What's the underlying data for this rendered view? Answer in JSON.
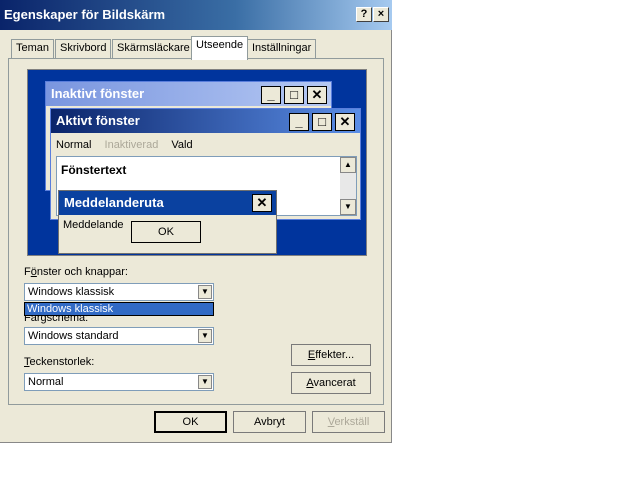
{
  "window": {
    "title": "Egenskaper för Bildskärm",
    "help_button": "?",
    "close_button": "×"
  },
  "tabs": [
    {
      "label": "Teman",
      "active": false
    },
    {
      "label": "Skrivbord",
      "active": false
    },
    {
      "label": "Skärmsläckare",
      "active": false
    },
    {
      "label": "Utseende",
      "active": true
    },
    {
      "label": "Inställningar",
      "active": false
    }
  ],
  "preview": {
    "inactive_title": "Inaktivt fönster",
    "active_title": "Aktivt fönster",
    "menu": {
      "normal": "Normal",
      "disabled": "Inaktiverad",
      "selected": "Vald"
    },
    "window_text": "Fönstertext",
    "messagebox_title": "Meddelanderuta",
    "message_text": "Meddelande",
    "ok_label": "OK"
  },
  "controls": {
    "windows_buttons_label_pre": "F",
    "windows_buttons_label_u": "ö",
    "windows_buttons_label_post": "nster och knappar:",
    "windows_buttons_value": "Windows klassisk",
    "dropdown_option": "Windows klassisk",
    "color_scheme_label": "Färgschema:",
    "color_scheme_value": "Windows standard",
    "font_size_label_u": "T",
    "font_size_label_post": "eckenstorlek:",
    "font_size_value": "Normal",
    "effects_u": "E",
    "effects_post": "ffekter...",
    "advanced_u": "A",
    "advanced_post": "vancerat"
  },
  "footer": {
    "ok": "OK",
    "cancel": "Avbryt",
    "apply_u": "V",
    "apply_post": "erkställ"
  },
  "colors": {
    "titlebar": "#0a246a",
    "preview_desktop": "#00349d",
    "selection": "#316ac5"
  }
}
